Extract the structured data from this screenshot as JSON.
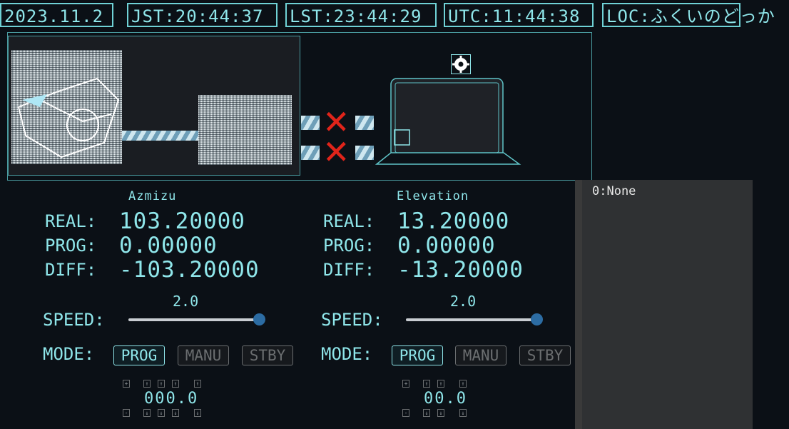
{
  "header": {
    "date": "2023.11.2",
    "jst": "JST:20:44:37",
    "lst": "LST:23:44:29",
    "utc": "UTC:11:44:38",
    "loc": "LOC:ふくいのどっか"
  },
  "azimuth": {
    "title": "Azmizu",
    "real_label": "REAL:",
    "real_value": "103.20000",
    "prog_label": "PROG:",
    "prog_value": "0.00000",
    "diff_label": "DIFF:",
    "diff_value": "-103.20000",
    "speed_label": "SPEED:",
    "speed_value": "2.0",
    "speed_level": 1.0,
    "mode_label": "MODE:",
    "modes": [
      "PROG",
      "MANU",
      "STBY"
    ],
    "active_mode": "PROG",
    "step_display": "000.0",
    "step_plus_symbol": "+",
    "step_minus_symbol": "-"
  },
  "elevation": {
    "title": "Elevation",
    "real_label": "REAL:",
    "real_value": "13.20000",
    "prog_label": "PROG:",
    "prog_value": "0.00000",
    "diff_label": "DIFF:",
    "diff_value": "-13.20000",
    "speed_label": "SPEED:",
    "speed_value": "2.0",
    "speed_level": 1.0,
    "mode_label": "MODE:",
    "modes": [
      "PROG",
      "MANU",
      "STBY"
    ],
    "active_mode": "PROG",
    "step_display": "00.0",
    "step_plus_symbol": "+",
    "step_minus_symbol": "-"
  },
  "log": {
    "entry": "0:None"
  },
  "colors": {
    "accent": "#8fe6ea",
    "error": "#e0241a",
    "slider_knob": "#2c6ca3"
  },
  "icons": {
    "disconnect": "x-mark-icon",
    "settings": "gear-icon",
    "computer": "laptop-icon"
  }
}
